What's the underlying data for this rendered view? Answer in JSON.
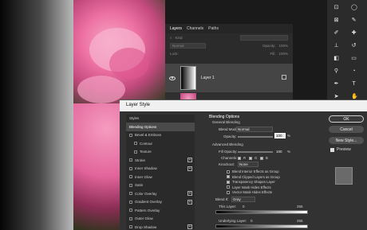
{
  "layers_panel": {
    "tabs": [
      "Layers",
      "Channels",
      "Paths"
    ],
    "kind_label": "Kind",
    "blend_mode": "Normal",
    "opacity_label": "Opacity:",
    "opacity_value": "100%",
    "lock_label": "Lock:",
    "fill_label": "Fill:",
    "fill_value": "100%",
    "layer_name": "Layer 1"
  },
  "dialog": {
    "title": "Layer Style",
    "styles_header": "Styles",
    "styles": [
      {
        "label": "Blending Options",
        "selected": true,
        "checkbox": false,
        "plus": false,
        "indent": false
      },
      {
        "label": "Bevel & Emboss",
        "checkbox": true,
        "plus": false,
        "indent": false
      },
      {
        "label": "Contour",
        "checkbox": true,
        "plus": false,
        "indent": true
      },
      {
        "label": "Texture",
        "checkbox": true,
        "plus": false,
        "indent": true
      },
      {
        "label": "Stroke",
        "checkbox": true,
        "plus": true,
        "indent": false
      },
      {
        "label": "Inner Shadow",
        "checkbox": true,
        "plus": true,
        "indent": false
      },
      {
        "label": "Inner Glow",
        "checkbox": true,
        "plus": false,
        "indent": false
      },
      {
        "label": "Satin",
        "checkbox": true,
        "plus": false,
        "indent": false
      },
      {
        "label": "Color Overlay",
        "checkbox": true,
        "plus": true,
        "indent": false
      },
      {
        "label": "Gradient Overlay",
        "checkbox": true,
        "plus": true,
        "indent": false
      },
      {
        "label": "Pattern Overlay",
        "checkbox": true,
        "plus": false,
        "indent": false
      },
      {
        "label": "Outer Glow",
        "checkbox": true,
        "plus": false,
        "indent": false
      },
      {
        "label": "Drop Shadow",
        "checkbox": true,
        "plus": true,
        "indent": false
      }
    ],
    "blending": {
      "heading": "Blending Options",
      "general": "General Blending",
      "blend_mode_label": "Blend Mode:",
      "blend_mode_value": "Normal",
      "opacity_label": "Opacity:",
      "opacity_value": "100",
      "percent": "%",
      "advanced": "Advanced Blending",
      "fill_opacity_label": "Fill Opacity:",
      "fill_opacity_value": "100",
      "channels_label": "Channels:",
      "channel_r": "R",
      "channel_g": "G",
      "channel_b": "B",
      "knockout_label": "Knockout:",
      "knockout_value": "None",
      "options": [
        {
          "label": "Blend Interior Effects as Group",
          "checked": false
        },
        {
          "label": "Blend Clipped Layers as Group",
          "checked": true
        },
        {
          "label": "Transparency Shapes Layer",
          "checked": true
        },
        {
          "label": "Layer Mask Hides Effects",
          "checked": false
        },
        {
          "label": "Vector Mask Hides Effects",
          "checked": false
        }
      ],
      "blend_if_label": "Blend If:",
      "blend_if_value": "Gray",
      "this_layer_label": "This Layer:",
      "this_layer_low": "0",
      "this_layer_high": "255",
      "underlying_label": "Underlying Layer:",
      "underlying_low": "0",
      "underlying_high": "255"
    },
    "buttons": {
      "ok": "OK",
      "cancel": "Cancel",
      "new_style": "New Style...",
      "preview": "Preview"
    }
  }
}
